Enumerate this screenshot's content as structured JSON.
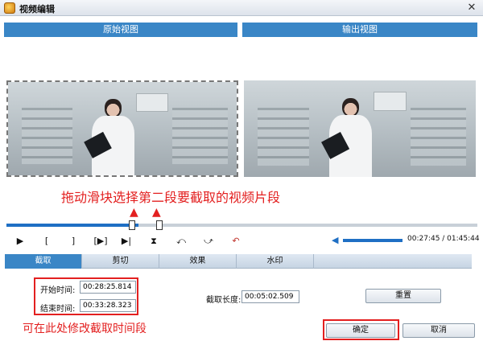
{
  "window": {
    "title": "视频编辑",
    "close_glyph": "✕"
  },
  "views": {
    "left_title": "原始视图",
    "right_title": "输出视图"
  },
  "annotations": {
    "drag_hint": "拖动滑块选择第二段要截取的视频片段",
    "edit_hint": "可在此处修改截取时间段",
    "arrow_glyph": "▲",
    "color": "#e32020"
  },
  "timeline": {
    "progress": 0.28,
    "start_marker_icon": "slider-thumb",
    "end_marker_icon": "slider-thumb"
  },
  "controls": {
    "play": "▶",
    "mark_in": "[",
    "mark_out": "]",
    "jump_segment": "[▶]",
    "step_frame": "▶|",
    "flip_vertical": "⧗",
    "rotate_left": "⤺",
    "rotate_right": "⤻",
    "undo": "↶"
  },
  "volume": {
    "icon": "speaker-icon",
    "glyph": "◀",
    "level": 1.0
  },
  "time_display": "00:27:45 / 01:45:44",
  "tabs": [
    {
      "label": "截取",
      "active": true
    },
    {
      "label": "剪切",
      "active": false
    },
    {
      "label": "效果",
      "active": false
    },
    {
      "label": "水印",
      "active": false
    }
  ],
  "form": {
    "start_label": "开始时间:",
    "start_value": "00:28:25.814",
    "end_label": "结束时间:",
    "end_value": "00:33:28.323",
    "length_label": "截取长度:",
    "length_value": "00:05:02.509",
    "reset_label": "重置"
  },
  "footer": {
    "ok_label": "确定",
    "cancel_label": "取消"
  },
  "colors": {
    "accent": "#3a86c6",
    "annotation_red": "#e32020",
    "progress_blue": "#1f6fc4"
  }
}
